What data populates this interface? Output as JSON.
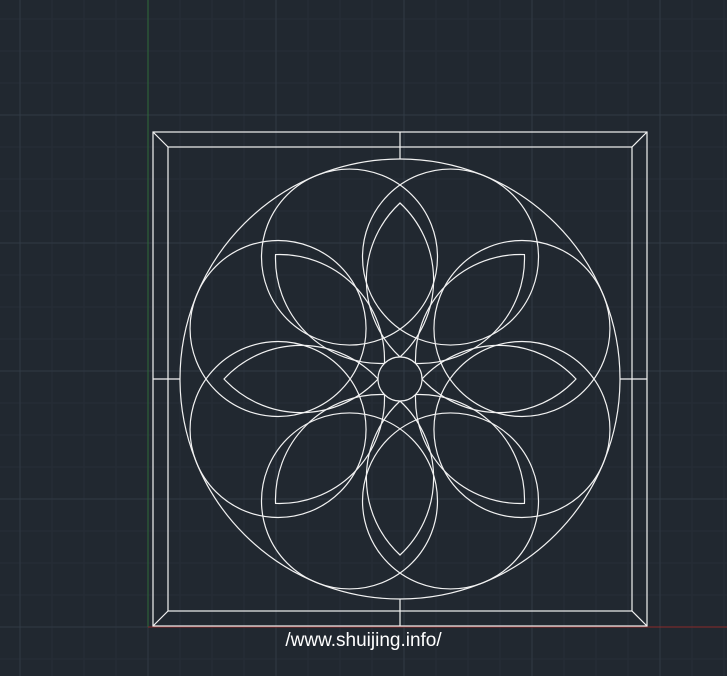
{
  "viewport": {
    "background": "#212830",
    "grid_minor_color": "#262e37",
    "grid_major_color": "#313a45",
    "axis_x_color": "#8a2a2a",
    "axis_y_color": "#2e6b3a",
    "geometry_color": "#f2f2f2"
  },
  "drawing": {
    "design": "rosette-in-square-frame",
    "petal_count": 8,
    "elements": [
      "outer-square",
      "inner-square",
      "outer-circle",
      "petal-arcs",
      "ring-arcs",
      "center-circle",
      "mid-ticks"
    ]
  },
  "watermark": {
    "text": "/www.shuijing.info/"
  }
}
